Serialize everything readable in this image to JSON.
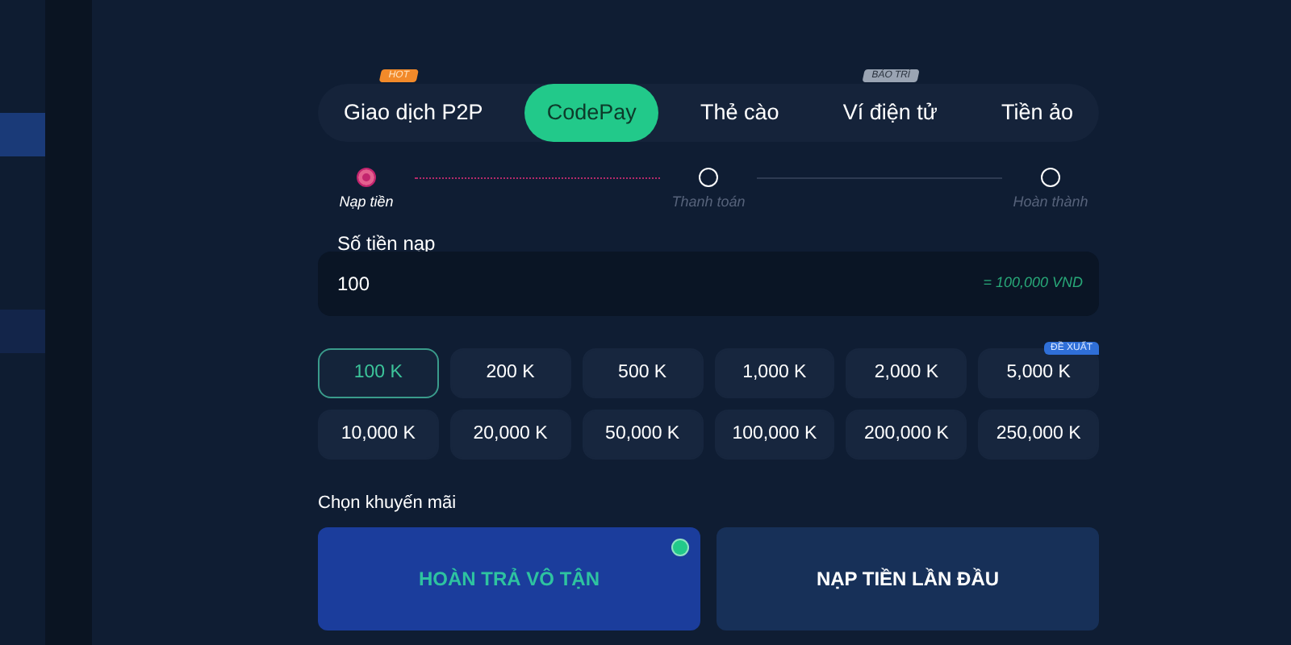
{
  "sidebar": {
    "items": [
      {
        "selected": true
      },
      {
        "selected": false
      }
    ]
  },
  "tabs": [
    {
      "label": "Giao dịch P2P",
      "selected": false,
      "badge": {
        "text": "HOT",
        "color": "#f28a2a"
      }
    },
    {
      "label": "CodePay",
      "selected": true
    },
    {
      "label": "Thẻ cào",
      "selected": false
    },
    {
      "label": "Ví điện tử",
      "selected": false,
      "badge": {
        "text": "BẢO TRÌ",
        "color": "#9aa4b3"
      }
    },
    {
      "label": "Tiền ảo",
      "selected": false
    }
  ],
  "steps": [
    {
      "label": "Nạp tiền",
      "active": true
    },
    {
      "label": "Thanh toán",
      "active": false
    },
    {
      "label": "Hoàn thành",
      "active": false
    }
  ],
  "amount": {
    "label": "Số tiền nạp",
    "value": "100",
    "conversion": "= 100,000 VND"
  },
  "presets": [
    {
      "label": "100 K",
      "selected": true
    },
    {
      "label": "200 K",
      "selected": false
    },
    {
      "label": "500 K",
      "selected": false
    },
    {
      "label": "1,000 K",
      "selected": false
    },
    {
      "label": "2,000 K",
      "selected": false
    },
    {
      "label": "5,000 K",
      "selected": false,
      "badge": "ĐỀ XUẤT"
    },
    {
      "label": "10,000 K",
      "selected": false
    },
    {
      "label": "20,000 K",
      "selected": false
    },
    {
      "label": "50,000 K",
      "selected": false
    },
    {
      "label": "100,000 K",
      "selected": false
    },
    {
      "label": "200,000 K",
      "selected": false
    },
    {
      "label": "250,000 K",
      "selected": false
    }
  ],
  "promotion": {
    "label": "Chọn khuyến mãi",
    "options": [
      {
        "label": "HOÀN TRẢ VÔ TẬN",
        "selected": true
      },
      {
        "label": "NẠP TIỀN LẦN ĐẦU",
        "selected": false
      }
    ]
  }
}
